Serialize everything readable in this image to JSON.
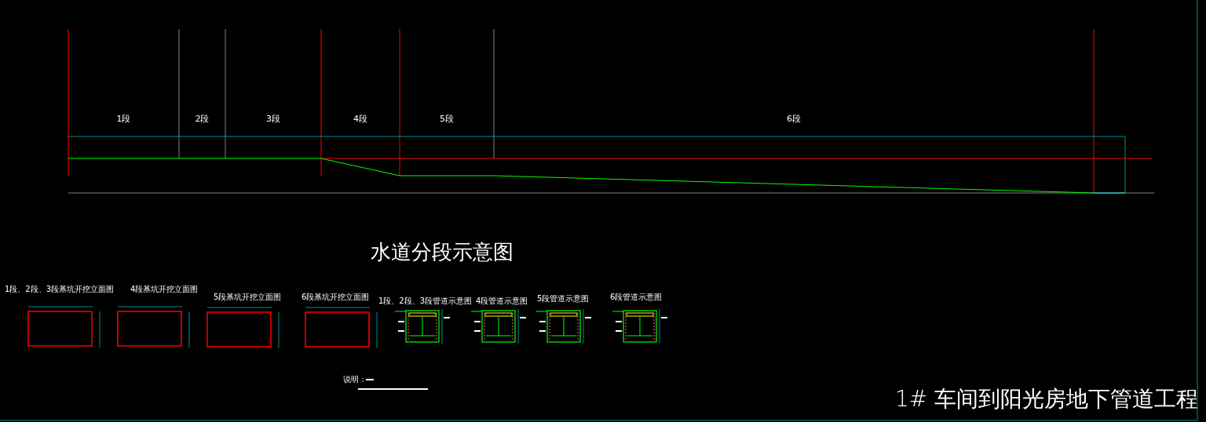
{
  "segments": [
    {
      "label": "1段"
    },
    {
      "label": "2段"
    },
    {
      "label": "3段"
    },
    {
      "label": "4段"
    },
    {
      "label": "5段"
    },
    {
      "label": "6段"
    }
  ],
  "main_title": "水道分段示意图",
  "elevations": [
    {
      "title": "1段、2段、3段基坑开挖立面图"
    },
    {
      "title": "4段基坑开挖立面图"
    },
    {
      "title": "5段基坑开挖立面图"
    },
    {
      "title": "6段基坑开挖立面图"
    }
  ],
  "pipe_sections": [
    {
      "title": "1段、2段、3段管道示意图"
    },
    {
      "title": "4段管道示意图"
    },
    {
      "title": "5段管道示意图"
    },
    {
      "title": "6段管道示意图"
    }
  ],
  "note_label": "说明：",
  "project_title": "1# 车间到阳光房地下管道工程"
}
